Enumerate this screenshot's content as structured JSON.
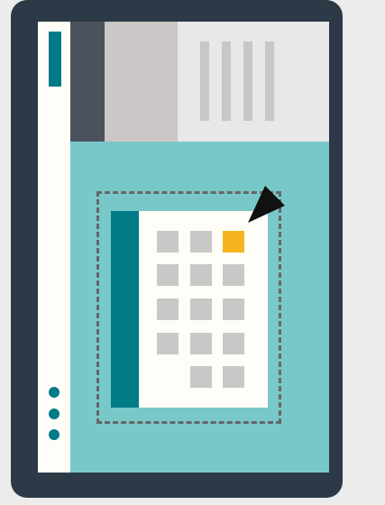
{
  "screen": {
    "title": "",
    "tile_grid": {
      "rows": 5,
      "columns": 3,
      "highlighted_tile": "row 1, column 3"
    },
    "colors": {
      "device_frame": "#2c3a47",
      "screen_background": "#79c8c9",
      "sidebar_background": "#fffdf7",
      "accent": "#007b87",
      "highlight": "#f6b51f",
      "tile": "#cac8c6"
    },
    "icons": {
      "pointer": "arrow-cursor-icon",
      "more": "more-vertical-icon"
    }
  }
}
